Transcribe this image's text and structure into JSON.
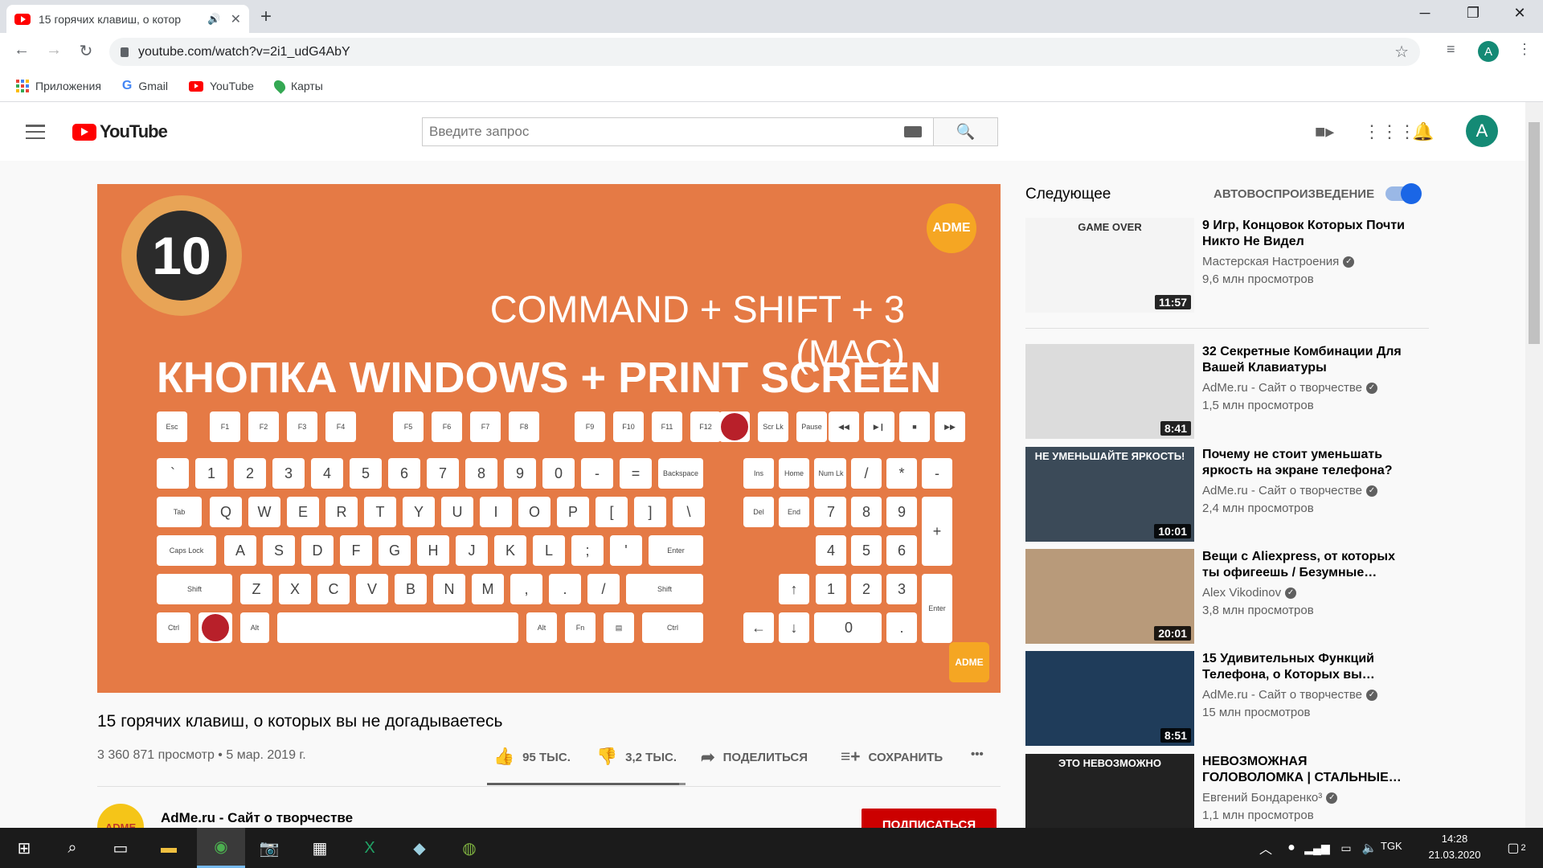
{
  "browser": {
    "tab_title": "15 горячих клавиш, о котор",
    "url": "youtube.com/watch?v=2i1_udG4AbY",
    "profile_initial": "A",
    "bookmarks": [
      "Приложения",
      "Gmail",
      "YouTube",
      "Карты"
    ]
  },
  "youtube": {
    "logo_text": "YouTube",
    "search_placeholder": "Введите запрос",
    "user_initial": "A"
  },
  "video": {
    "overlay_number": "10",
    "overlay_brand": "ADME",
    "overlay_line1": "COMMAND + SHIFT + 3 (MAC)",
    "overlay_line2": "КНОПКА WINDOWS + PRINT SCREEN",
    "title": "15 горячих клавиш, о которых вы не догадываетесь",
    "info": "3 360 871 просмотр • 5 мар. 2019 г.",
    "likes": "95 ТЫС.",
    "dislikes": "3,2 ТЫС.",
    "like_ratio": 0.967,
    "share_label": "ПОДЕЛИТЬСЯ",
    "save_label": "СОХРАНИТЬ",
    "more_label": "•••",
    "channel": "AdMe.ru - Сайт о творчестве",
    "channel_avatar_text": "ADME",
    "subscribe_label": "ПОДПИСАТЬСЯ"
  },
  "sidebar": {
    "next_label": "Следующее",
    "autoplay_label": "АВТОВОСПРОИЗВЕДЕНИЕ",
    "autoplay_on": true,
    "items": [
      {
        "title": "9 Игр, Концовок Которых Почти Никто Не Видел",
        "channel": "Мастерская Настроения",
        "views": "9,6 млн просмотров",
        "duration": "11:57",
        "thumb_text": "GAME OVER",
        "color": "#f4f4f4"
      },
      {
        "title": "32 Секретные Комбинации Для Вашей Клавиатуры",
        "channel": "AdMe.ru - Сайт о творчестве",
        "views": "1,5 млн просмотров",
        "duration": "8:41",
        "thumb_text": "",
        "color": "#dcdcdc"
      },
      {
        "title": "Почему не стоит уменьшать яркость на экране телефона?",
        "channel": "AdMe.ru - Сайт о творчестве",
        "views": "2,4 млн просмотров",
        "duration": "10:01",
        "thumb_text": "НЕ УМЕНЬШАЙТЕ ЯРКОСТЬ!",
        "color": "#3b4a58"
      },
      {
        "title": "Вещи с Aliexpress, от которых ты офигеешь / Безумные…",
        "channel": "Alex Vikodinov",
        "views": "3,8 млн просмотров",
        "duration": "20:01",
        "thumb_text": "",
        "color": "#b89a7a"
      },
      {
        "title": "15 Удивительных Функций Телефона, о Которых вы…",
        "channel": "AdMe.ru - Сайт о творчестве",
        "views": "15 млн просмотров",
        "duration": "8:51",
        "thumb_text": "",
        "color": "#1f3c5a"
      },
      {
        "title": "НЕВОЗМОЖНАЯ ГОЛОВОЛОМКА | СТАЛЬНЫЕ…",
        "channel": "Евгений Бондаренко³",
        "views": "1,1 млн просмотров",
        "duration": "",
        "thumb_text": "ЭТО НЕВОЗМОЖНО",
        "color": "#222222"
      }
    ]
  },
  "taskbar": {
    "lang": "TGK",
    "time": "14:28",
    "date": "21.03.2020",
    "notifications": "2"
  }
}
